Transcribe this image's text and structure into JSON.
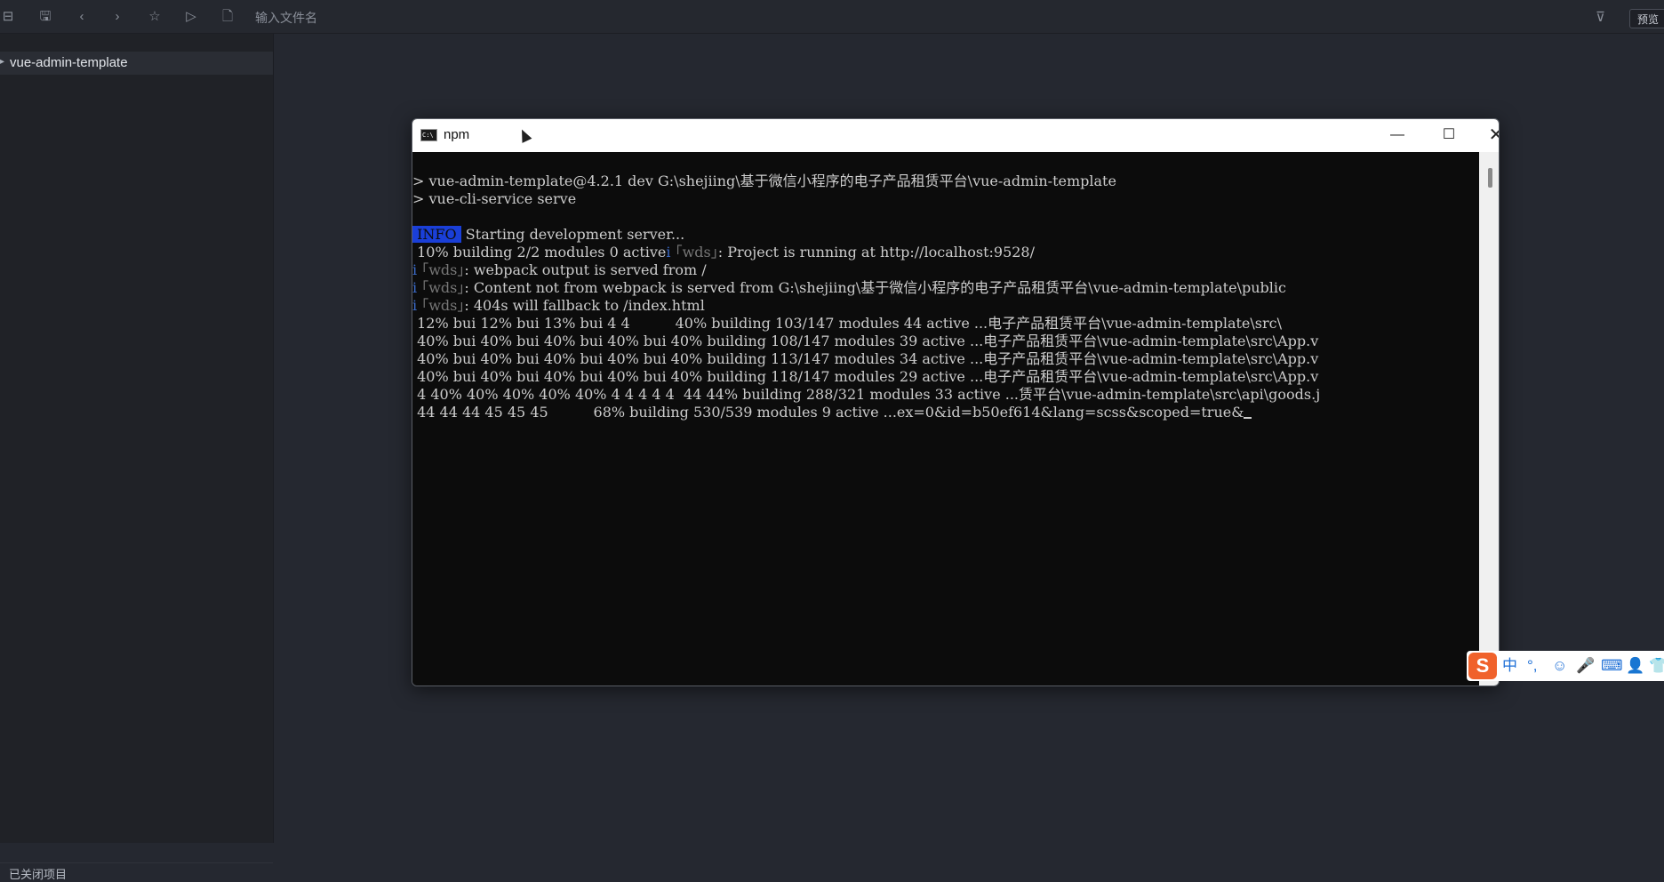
{
  "toolbar": {
    "icons": [
      "close-icon",
      "save-icon",
      "back-icon",
      "forward-icon",
      "star-icon",
      "play-icon",
      "file-search-icon"
    ],
    "search_placeholder": "输入文件名",
    "filter_icon": "filter-icon",
    "preview_label": "预览"
  },
  "sidebar": {
    "project": "vue-admin-template",
    "bottom_label": "已关闭项目"
  },
  "terminal": {
    "title": "npm",
    "lines": [
      {
        "prefix": "> ",
        "text": "vue-admin-template@4.2.1 dev G:\\shejiing\\基于微信小程序的电子产品租赁平台\\vue-admin-template"
      },
      {
        "prefix": "> ",
        "text": "vue-cli-service serve"
      },
      {
        "prefix": "",
        "text": ""
      },
      {
        "badge": " INFO ",
        "text": " Starting development server..."
      },
      {
        "text": " 10% building 2/2 modules 0 active",
        "tail_i": "i ",
        "tail_wds": "｢wds｣",
        "tail": ": Project is running at http://localhost:9528/"
      },
      {
        "pre_i": "i ",
        "pre_wds": "｢wds｣",
        "text": ": webpack output is served from /"
      },
      {
        "pre_i": "i ",
        "pre_wds": "｢wds｣",
        "text": ": Content not from webpack is served from G:\\shejiing\\基于微信小程序的电子产品租赁平台\\vue-admin-template\\public"
      },
      {
        "pre_i": "i ",
        "pre_wds": "｢wds｣",
        "text": ": 404s will fallback to /index.html"
      },
      {
        "text": " 12% bui 12% bui 13% bui 4 4          40% building 103/147 modules 44 active ...电子产品租赁平台\\vue-admin-template\\src\\"
      },
      {
        "text": " 40% bui 40% bui 40% bui 40% bui 40% building 108/147 modules 39 active ...电子产品租赁平台\\vue-admin-template\\src\\App.v"
      },
      {
        "text": " 40% bui 40% bui 40% bui 40% bui 40% building 113/147 modules 34 active ...电子产品租赁平台\\vue-admin-template\\src\\App.v"
      },
      {
        "text": " 40% bui 40% bui 40% bui 40% bui 40% building 118/147 modules 29 active ...电子产品租赁平台\\vue-admin-template\\src\\App.v"
      },
      {
        "text": " 4 40% 40% 40% 40% 40% 4 4 4 4 4  44 44% building 288/321 modules 33 active ...赁平台\\vue-admin-template\\src\\api\\goods.j"
      },
      {
        "text": " 44 44 44 45 45 45          68% building 530/539 modules 9 active ...ex=0&id=b50ef614&lang=scss&scoped=true&",
        "cursor": true
      }
    ]
  },
  "ime": {
    "logo": "S",
    "items": [
      "中",
      "°,",
      "☺",
      "🎤",
      "⌨",
      "👤",
      "👕"
    ]
  }
}
